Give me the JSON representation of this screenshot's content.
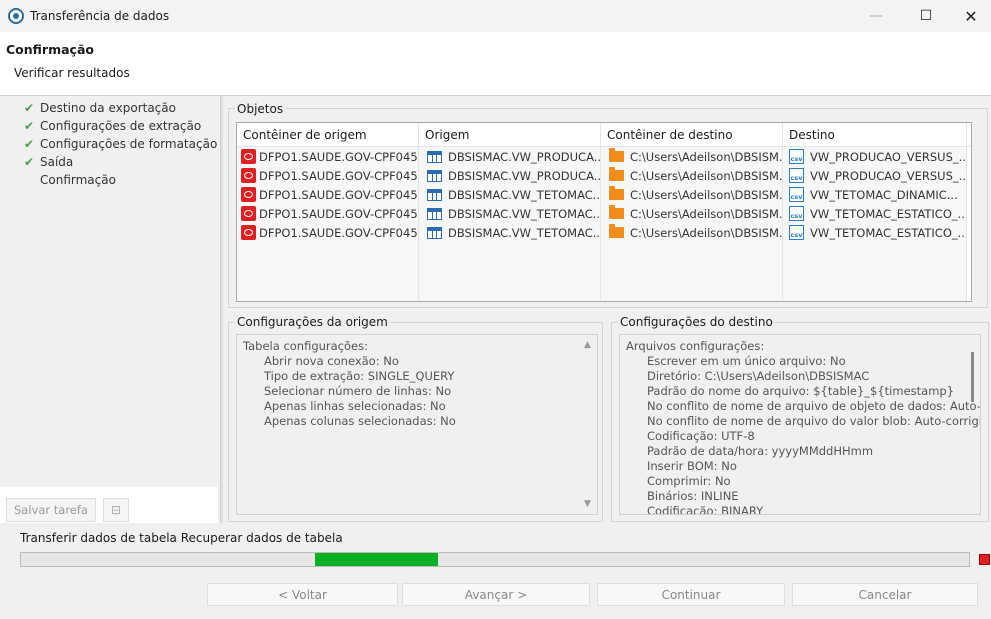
{
  "window": {
    "title": "Transferência de dados"
  },
  "header": {
    "title": "Confirmação",
    "subtitle": "Verificar resultados"
  },
  "steps": [
    {
      "label": "Destino da exportação",
      "done": true
    },
    {
      "label": "Configurações de extração",
      "done": true
    },
    {
      "label": "Configurações de formatação",
      "done": true
    },
    {
      "label": "Saída",
      "done": true
    },
    {
      "label": "Confirmação",
      "done": false
    }
  ],
  "sidebar": {
    "save_task_label": "Salvar tarefa"
  },
  "objects": {
    "group_label": "Objetos",
    "columns": [
      "Contêiner de origem",
      "Origem",
      "Contêiner de destino",
      "Destino"
    ],
    "rows": [
      [
        "DFPO1.SAUDE.GOV-CPF045...",
        "DBSISMAC.VW_PRODUCA...",
        "C:\\Users\\Adeilson\\DBSISM...",
        "VW_PRODUCAO_VERSUS_..."
      ],
      [
        "DFPO1.SAUDE.GOV-CPF045...",
        "DBSISMAC.VW_PRODUCA...",
        "C:\\Users\\Adeilson\\DBSISM...",
        "VW_PRODUCAO_VERSUS_..."
      ],
      [
        "DFPO1.SAUDE.GOV-CPF045...",
        "DBSISMAC.VW_TETOMAC...",
        "C:\\Users\\Adeilson\\DBSISM...",
        "VW_TETOMAC_DINAMIC..."
      ],
      [
        "DFPO1.SAUDE.GOV-CPF045...",
        "DBSISMAC.VW_TETOMAC...",
        "C:\\Users\\Adeilson\\DBSISM...",
        "VW_TETOMAC_ESTATICO_..."
      ],
      [
        "DFPO1.SAUDE.GOV-CPF045...",
        "DBSISMAC.VW_TETOMAC...",
        "C:\\Users\\Adeilson\\DBSISM...",
        "VW_TETOMAC_ESTATICO_..."
      ]
    ]
  },
  "source_config": {
    "group_label": "Configurações da origem",
    "lines": [
      {
        "text": "Tabela configurações:",
        "indent": false
      },
      {
        "text": "Abrir nova conexão: No",
        "indent": true
      },
      {
        "text": "Tipo de extração: SINGLE_QUERY",
        "indent": true
      },
      {
        "text": "Selecionar número de linhas: No",
        "indent": true
      },
      {
        "text": "Apenas linhas selecionadas: No",
        "indent": true
      },
      {
        "text": "Apenas colunas selecionadas: No",
        "indent": true
      }
    ]
  },
  "dest_config": {
    "group_label": "Configurações do destino",
    "lines": [
      {
        "text": "Arquivos configurações:",
        "indent": false
      },
      {
        "text": "Escrever em um único arquivo: No",
        "indent": true
      },
      {
        "text": "Diretório: C:\\Users\\Adeilson\\DBSISMAC",
        "indent": true
      },
      {
        "text": "Padrão do nome do arquivo: ${table}_${timestamp}",
        "indent": true
      },
      {
        "text": "No conflito de nome de arquivo de objeto de dados: Auto-c",
        "indent": true
      },
      {
        "text": "No conflito de nome de arquivo do valor blob: Auto-corrigi",
        "indent": true
      },
      {
        "text": "Codificação: UTF-8",
        "indent": true
      },
      {
        "text": "Padrão de data/hora: yyyyMMddHHmm",
        "indent": true
      },
      {
        "text": "Inserir BOM: No",
        "indent": true
      },
      {
        "text": "Comprimir: No",
        "indent": true
      },
      {
        "text": "Binários: INLINE",
        "indent": true
      },
      {
        "text": "Codificação: BINARY",
        "indent": true
      }
    ]
  },
  "progress": {
    "label": "Transferir dados de tabela Recuperar dados de tabela",
    "indicator_start": 0.31,
    "indicator_end": 0.44,
    "color": "#06b025"
  },
  "footer": {
    "back_label": "< Voltar",
    "next_label": "Avançar >",
    "continue_label": "Continuar",
    "cancel_label": "Cancelar"
  }
}
